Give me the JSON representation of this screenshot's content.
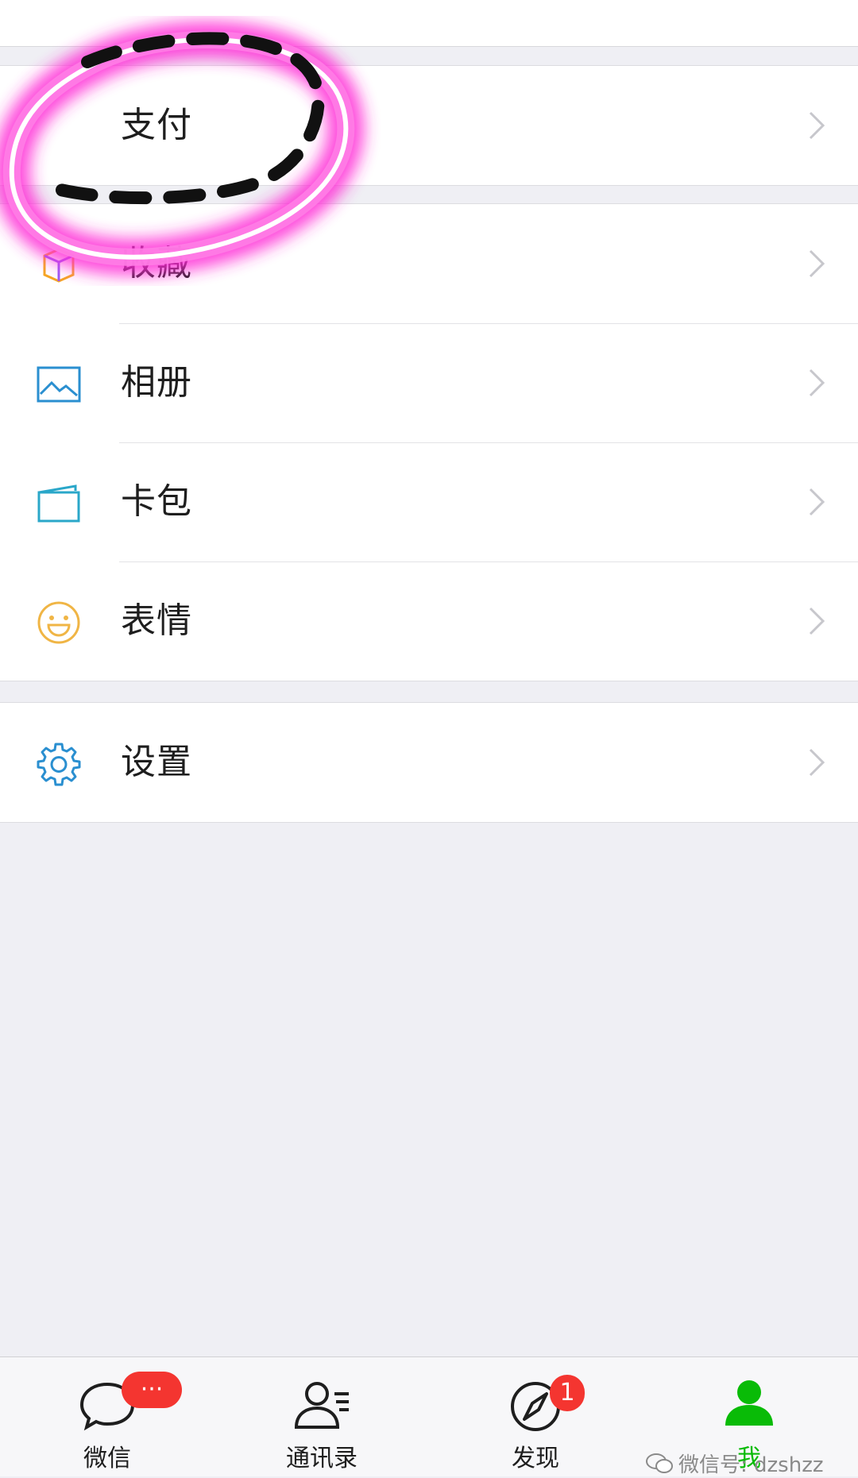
{
  "menu": {
    "sections": [
      {
        "items": [
          {
            "label": "支付",
            "icon": "payment-icon"
          }
        ]
      },
      {
        "items": [
          {
            "label": "收藏",
            "icon": "favorites-cube-icon"
          },
          {
            "label": "相册",
            "icon": "photo-album-icon"
          },
          {
            "label": "卡包",
            "icon": "card-wallet-icon"
          },
          {
            "label": "表情",
            "icon": "smiley-face-icon"
          }
        ]
      },
      {
        "items": [
          {
            "label": "设置",
            "icon": "gear-icon"
          }
        ]
      }
    ]
  },
  "tabbar": {
    "tabs": [
      {
        "label": "微信",
        "icon": "chat-bubble-icon",
        "badge": "···"
      },
      {
        "label": "通讯录",
        "icon": "contacts-icon"
      },
      {
        "label": "发现",
        "icon": "compass-icon",
        "badge": "1"
      },
      {
        "label": "我",
        "icon": "person-icon",
        "active": true
      }
    ]
  },
  "watermark": {
    "text": "微信号: dzshzz"
  },
  "colors": {
    "accent_green": "#09bb07",
    "badge_red": "#f43530",
    "annotation_pink": "#ff2bd6",
    "background": "#efeff4"
  }
}
